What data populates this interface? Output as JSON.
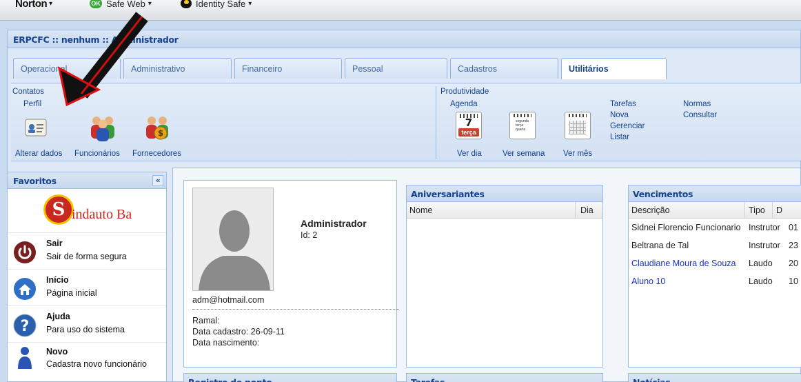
{
  "norton_toolbar": {
    "brand": "Norton",
    "safe_web_badge": "OK",
    "safe_web_label": "Safe Web",
    "identity_safe_label": "Identity Safe",
    "dropdown_glyph": "▾"
  },
  "window": {
    "title": "ERPCFC :: nenhum :: Administrador"
  },
  "tabs": [
    {
      "label": "Operacional",
      "active": false
    },
    {
      "label": "Administrativo",
      "active": false
    },
    {
      "label": "Financeiro",
      "active": false
    },
    {
      "label": "Pessoal",
      "active": false
    },
    {
      "label": "Cadastros",
      "active": false
    },
    {
      "label": "Utilitários",
      "active": true
    }
  ],
  "ribbon": {
    "contatos": {
      "title": "Contatos",
      "subgroup": "Perfil",
      "labels": [
        "Alterar dados",
        "Funcionários",
        "Fornecedores"
      ]
    },
    "produtividade": {
      "title": "Produtividade",
      "agenda_label": "Agenda",
      "calendar_day": "7",
      "calendar_weekday": "terça",
      "week_lines": [
        "segunda",
        "terça",
        "quarta"
      ],
      "view_labels": [
        "Ver dia",
        "Ver semana",
        "Ver mês"
      ],
      "tarefas": {
        "title": "Tarefas",
        "items": [
          "Nova",
          "Gerenciar",
          "Listar"
        ]
      },
      "normas": {
        "title": "Normas",
        "items": [
          "Consultar"
        ]
      }
    }
  },
  "favoritos": {
    "title": "Favoritos",
    "collapse_glyph": "«",
    "logo_letter": "S",
    "logo_text": "indauto Ba",
    "items": [
      {
        "title": "Sair",
        "subtitle": "Sair de forma segura",
        "icon": "power-icon"
      },
      {
        "title": "Início",
        "subtitle": "Página inicial",
        "icon": "home-icon"
      },
      {
        "title": "Ajuda",
        "subtitle": "Para uso do sistema",
        "icon": "help-icon"
      },
      {
        "title": "Novo",
        "subtitle": "Cadastra novo funcionário",
        "icon": "new-user-icon"
      }
    ]
  },
  "profile": {
    "name": "Administrador",
    "id_line": "Id: 2",
    "email": "adm@hotmail.com",
    "ramal": "Ramal:",
    "data_cadastro": "Data cadastro: 26-09-11",
    "data_nascimento": "Data nascimento:"
  },
  "aniversariantes": {
    "title": "Aniversariantes",
    "columns": [
      "Nome",
      "Dia"
    ]
  },
  "vencimentos": {
    "title": "Vencimentos",
    "columns": [
      "Descrição",
      "Tipo",
      "D"
    ],
    "rows": [
      {
        "descricao": "Sidnei Florencio Funcionario",
        "tipo": "Instrutor",
        "d": "01",
        "link": false
      },
      {
        "descricao": "Beltrana de Tal",
        "tipo": "Instrutor",
        "d": "23",
        "link": false
      },
      {
        "descricao": "Claudiane Moura de Souza",
        "tipo": "Laudo",
        "d": "20",
        "link": true
      },
      {
        "descricao": "Aluno 10",
        "tipo": "Laudo",
        "d": "10",
        "link": true
      }
    ]
  },
  "bottom_panels": [
    "Registro de ponto",
    "Tarefas",
    "Notícias"
  ],
  "colors": {
    "header_text": "#15428b",
    "border": "#99bbe8",
    "link": "#1a2fc8",
    "arrow": "#e01010"
  }
}
